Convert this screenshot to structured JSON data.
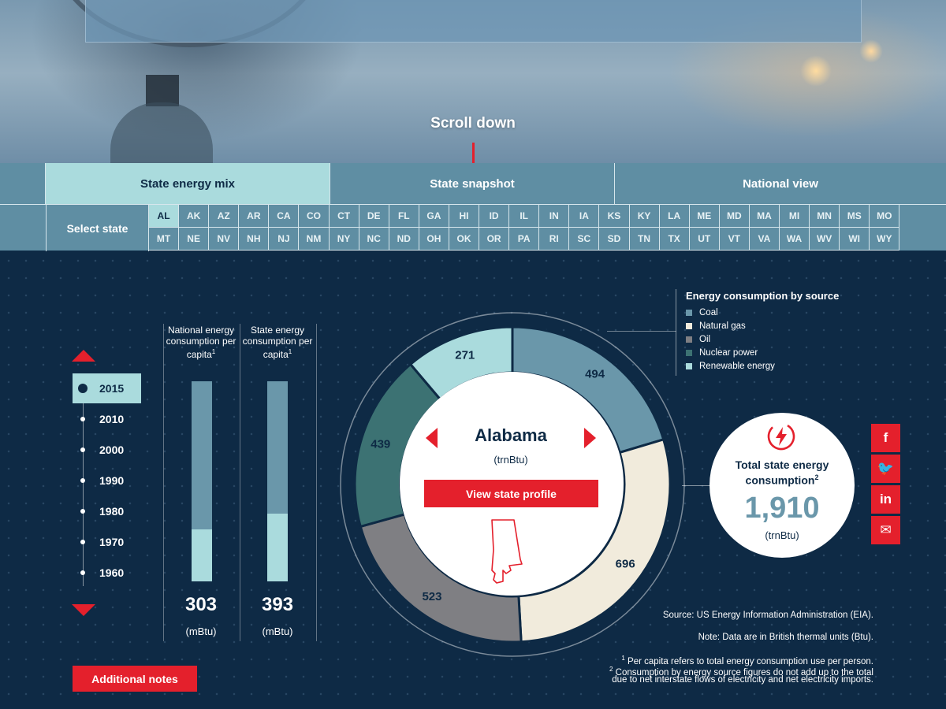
{
  "hero": {
    "scroll_label": "Scroll down"
  },
  "tabs": [
    {
      "label": "State energy mix",
      "active": true
    },
    {
      "label": "State snapshot",
      "active": false
    },
    {
      "label": "National view",
      "active": false
    }
  ],
  "state_selector": {
    "label": "Select state",
    "selected": "AL",
    "row1": [
      "AL",
      "AK",
      "AZ",
      "AR",
      "CA",
      "CO",
      "CT",
      "DE",
      "FL",
      "GA",
      "HI",
      "ID",
      "IL",
      "IN",
      "IA",
      "KS",
      "KY",
      "LA",
      "ME",
      "MD",
      "MA",
      "MI",
      "MN",
      "MS",
      "MO"
    ],
    "row2": [
      "MT",
      "NE",
      "NV",
      "NH",
      "NJ",
      "NM",
      "NY",
      "NC",
      "ND",
      "OH",
      "OK",
      "OR",
      "PA",
      "RI",
      "SC",
      "SD",
      "TN",
      "TX",
      "UT",
      "VT",
      "VA",
      "WA",
      "WV",
      "WI",
      "WY"
    ]
  },
  "years": {
    "selected": "2015",
    "items": [
      "2015",
      "2010",
      "2000",
      "1990",
      "1980",
      "1970",
      "1960"
    ]
  },
  "per_capita": {
    "national": {
      "label": "National energy consumption per capita",
      "note": "1",
      "value": "303",
      "unit": "(mBtu)",
      "fill_fraction": 0.26
    },
    "state": {
      "label": "State energy consumption per capita",
      "note": "1",
      "value": "393",
      "unit": "(mBtu)",
      "fill_fraction": 0.34
    }
  },
  "state_view": {
    "name": "Alabama",
    "unit": "(trnBtu)",
    "profile_button": "View state profile"
  },
  "donut": {
    "slices": [
      {
        "name": "Coal",
        "value": 494,
        "label": "494",
        "color": "#6a97aa",
        "text_color": "#0e2a45"
      },
      {
        "name": "Natural gas",
        "value": 696,
        "label": "696",
        "color": "#f1ebdc",
        "text_color": "#0e2a45"
      },
      {
        "name": "Oil",
        "value": 523,
        "label": "523",
        "color": "#7f7f83",
        "text_color": "#0e2a45"
      },
      {
        "name": "Nuclear power",
        "value": 439,
        "label": "439",
        "color": "#3c7273",
        "text_color": "#0e2a45"
      },
      {
        "name": "Renewable energy",
        "value": 271,
        "label": "271",
        "color": "#aadbdd",
        "text_color": "#0e2a45"
      }
    ]
  },
  "legend": {
    "title": "Energy consumption by source",
    "items": [
      {
        "label": "Coal",
        "color": "#6a97aa"
      },
      {
        "label": "Natural gas",
        "color": "#f1ebdc"
      },
      {
        "label": "Oil",
        "color": "#7f7f83"
      },
      {
        "label": "Nuclear power",
        "color": "#3c7273"
      },
      {
        "label": "Renewable energy",
        "color": "#aadbdd"
      }
    ]
  },
  "total": {
    "title": "Total state energy consumption",
    "note": "2",
    "value": "1,910",
    "unit": "(trnBtu)",
    "icon": "lightning-bolt-icon"
  },
  "social": [
    {
      "name": "facebook-icon",
      "glyph": "f"
    },
    {
      "name": "twitter-icon",
      "glyph": "🐦"
    },
    {
      "name": "linkedin-icon",
      "glyph": "in"
    },
    {
      "name": "email-icon",
      "glyph": "✉"
    }
  ],
  "footer": {
    "source": "Source: US Energy Information Administration (EIA).",
    "note": "Note: Data are in British thermal units (Btu).",
    "footnote1_marker": "1",
    "footnote1": "Per capita refers to total energy consumption use per person.",
    "footnote2_marker": "2",
    "footnote2_line1": "Consumption by energy source figures do not add up to the total",
    "footnote2_line2": "due to net interstate flows of electricity and net electricity imports.",
    "notes_button": "Additional notes"
  },
  "colors": {
    "accent": "#e4202c",
    "background": "#0e2a45",
    "teal_light": "#aadbdd",
    "teal_mid": "#5f8ea3"
  }
}
